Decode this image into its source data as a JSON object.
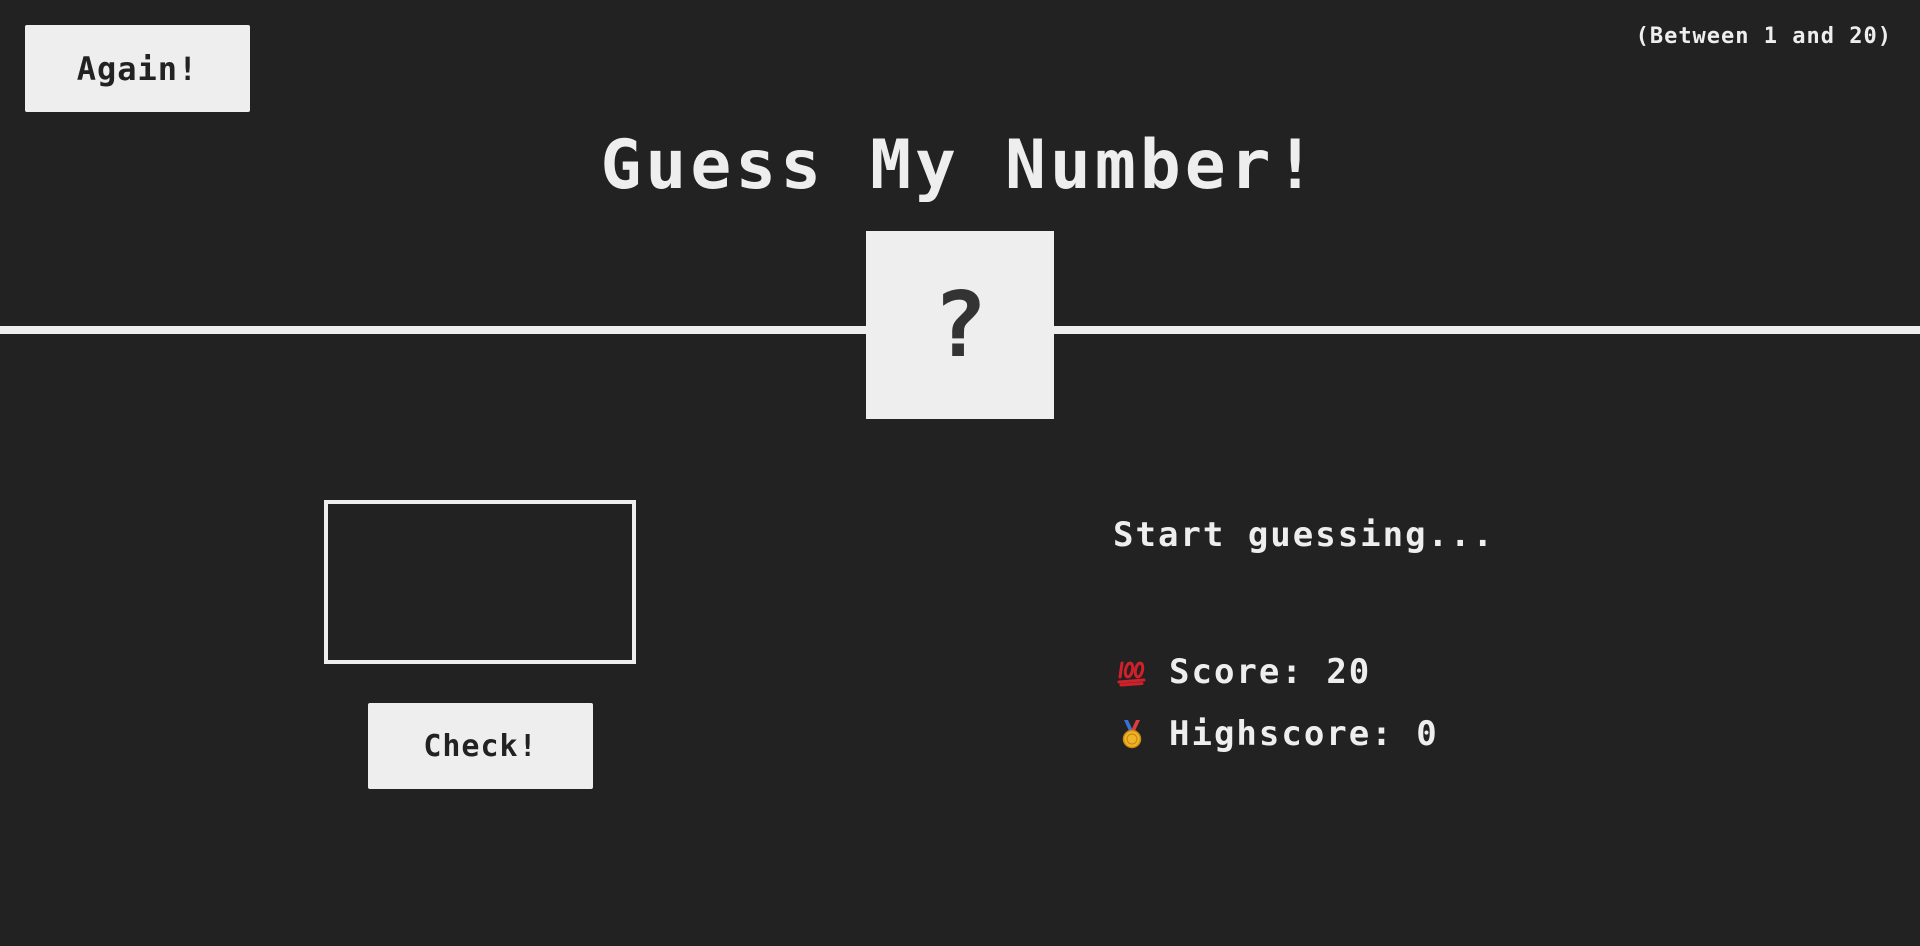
{
  "header": {
    "again_label": "Again!",
    "range_hint": "(Between 1 and 20)",
    "title": "Guess My Number!"
  },
  "secret": {
    "display": "?"
  },
  "guess": {
    "value": "",
    "input_type": "number"
  },
  "actions": {
    "check_label": "Check!"
  },
  "status": {
    "message": "Start guessing...",
    "score_label": "Score:",
    "score_value": "20",
    "highscore_label": "Highscore:",
    "highscore_value": "0",
    "score_icon": "hundred-points-icon",
    "highscore_icon": "medal-icon"
  },
  "colors": {
    "background": "#222222",
    "foreground": "#eeeeee",
    "score_icon_red": "#d0202a",
    "medal_gold": "#f2b428",
    "medal_ribbon": "#e03c3c"
  }
}
